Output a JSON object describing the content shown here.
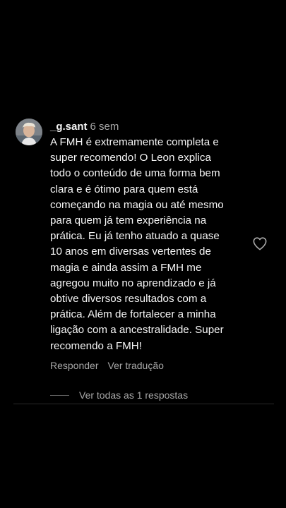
{
  "comment": {
    "username": "_g.sant",
    "time": "6 sem",
    "text": "A FMH é extremamente completa e\nsuper recomendo! O Leon explica\ntodo o conteúdo de uma forma bem\nclara e é ótimo para quem está\ncomeçando na magia ou até mesmo\npara quem já tem experiência na\nprática. Eu já tenho atuado a quase\n10 anos em diversas vertentes de\nmagia e ainda assim a FMH me\nagregou muito no aprendizado e já\nobtive diversos resultados com a\nprática. Além de fortalecer a minha\nligação com a ancestralidade. Super\nrecomendo a FMH!",
    "reply_label": "Responder",
    "translate_label": "Ver tradução",
    "view_replies_label": "Ver todas as 1 respostas",
    "like_icon": "heart-outline-icon"
  },
  "colors": {
    "background": "#000000",
    "primary_text": "#f5f5f5",
    "secondary_text": "#a8a8a8"
  }
}
